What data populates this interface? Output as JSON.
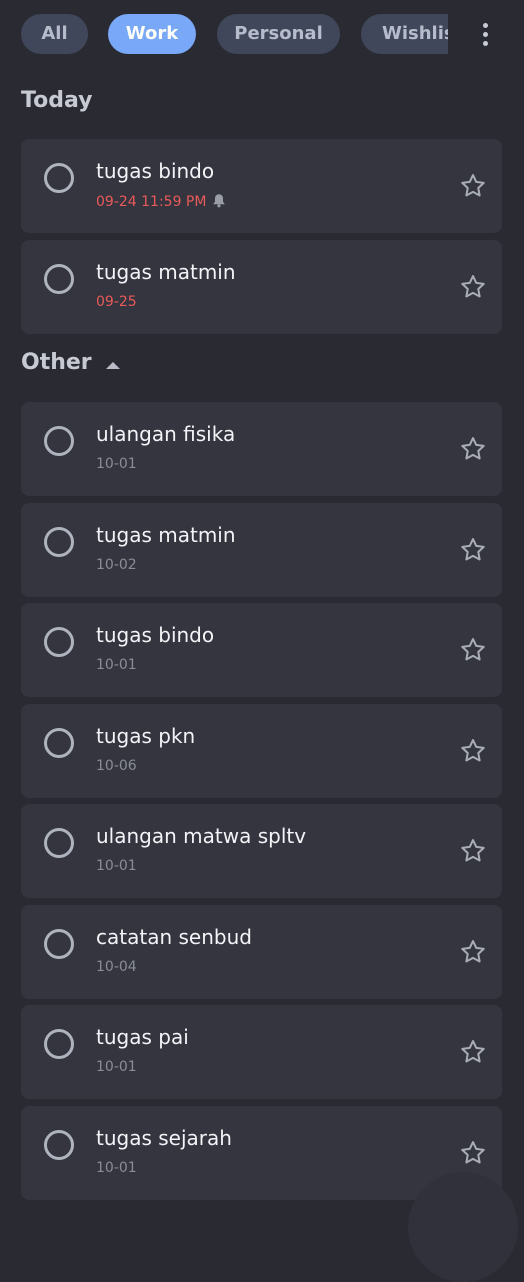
{
  "categories": [
    {
      "label": "All",
      "active": false
    },
    {
      "label": "Work",
      "active": true
    },
    {
      "label": "Personal",
      "active": false
    },
    {
      "label": "Wishlist",
      "active": false
    }
  ],
  "sections": {
    "today": {
      "label": "Today"
    },
    "other": {
      "label": "Other"
    }
  },
  "today_tasks": [
    {
      "title": "tugas bindo",
      "date": "09-24 11:59 PM",
      "reminder": true,
      "overdue": true
    },
    {
      "title": "tugas matmin",
      "date": "09-25",
      "reminder": false,
      "overdue": true
    }
  ],
  "other_tasks": [
    {
      "title": "ulangan fisika",
      "date": "10-01"
    },
    {
      "title": "tugas matmin",
      "date": "10-02"
    },
    {
      "title": "tugas bindo",
      "date": "10-01"
    },
    {
      "title": "tugas pkn",
      "date": "10-06"
    },
    {
      "title": "ulangan matwa spltv",
      "date": "10-01"
    },
    {
      "title": "catatan senbud",
      "date": "10-04"
    },
    {
      "title": "tugas pai",
      "date": "10-01"
    },
    {
      "title": "tugas sejarah",
      "date": "10-01"
    }
  ],
  "colors": {
    "background": "#2a2a32",
    "card": "#34353f",
    "chip": "#41475a",
    "chip_active": "#78a8f7",
    "overdue": "#e95a5a",
    "muted": "#8a8d97"
  },
  "icons": {
    "check": "circle-checkbox-icon",
    "star": "star-outline-icon",
    "bell": "bell-icon",
    "more": "more-vertical-icon",
    "collapse": "caret-up-icon"
  }
}
